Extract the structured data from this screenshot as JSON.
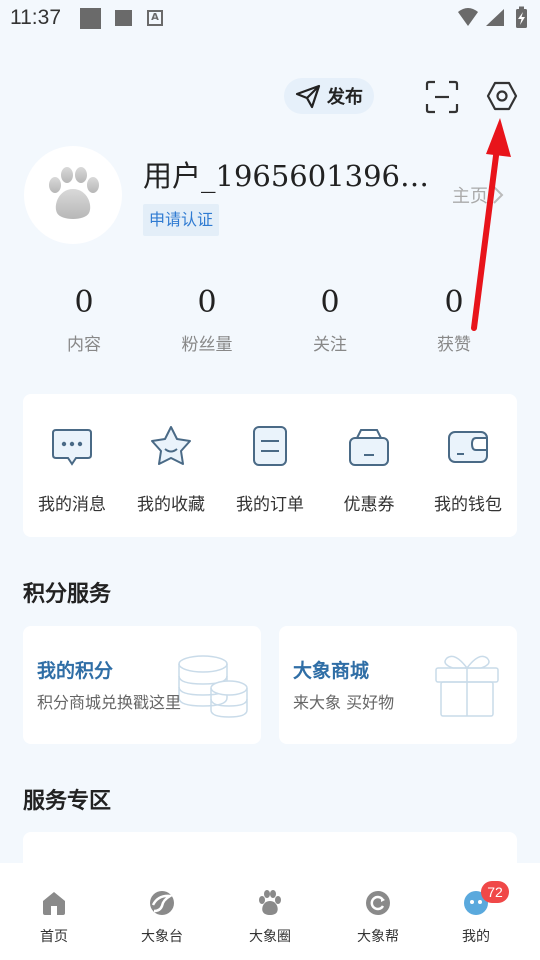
{
  "status_bar": {
    "time": "11:37"
  },
  "top_actions": {
    "publish_label": "发布"
  },
  "profile": {
    "username": "用户_1965601396…",
    "verify_label": "申请认证",
    "homepage_label": "主页"
  },
  "stats": [
    {
      "value": "0",
      "label": "内容"
    },
    {
      "value": "0",
      "label": "粉丝量"
    },
    {
      "value": "0",
      "label": "关注"
    },
    {
      "value": "0",
      "label": "获赞"
    }
  ],
  "shortcuts": [
    {
      "label": "我的消息",
      "icon": "message-icon"
    },
    {
      "label": "我的收藏",
      "icon": "star-icon"
    },
    {
      "label": "我的订单",
      "icon": "order-icon"
    },
    {
      "label": "优惠券",
      "icon": "coupon-icon"
    },
    {
      "label": "我的钱包",
      "icon": "wallet-icon"
    }
  ],
  "points_section": {
    "title": "积分服务",
    "cards": [
      {
        "title": "我的积分",
        "subtitle": "积分商城兑换戳这里",
        "icon": "coins-icon"
      },
      {
        "title": "大象商城",
        "subtitle": "来大象  买好物",
        "icon": "gift-box-icon"
      }
    ]
  },
  "service_section": {
    "title": "服务专区"
  },
  "tabbar": {
    "tabs": [
      {
        "label": "首页",
        "icon": "home-icon"
      },
      {
        "label": "大象台",
        "icon": "elephant-platform-icon"
      },
      {
        "label": "大象圈",
        "icon": "paw-icon"
      },
      {
        "label": "大象帮",
        "icon": "help-icon"
      },
      {
        "label": "我的",
        "icon": "profile-icon"
      }
    ],
    "badge": "72"
  },
  "colors": {
    "background": "#f3f8fd",
    "accent": "#2f7bd2",
    "badge": "#f04848",
    "annotation_arrow": "#e8141b"
  }
}
